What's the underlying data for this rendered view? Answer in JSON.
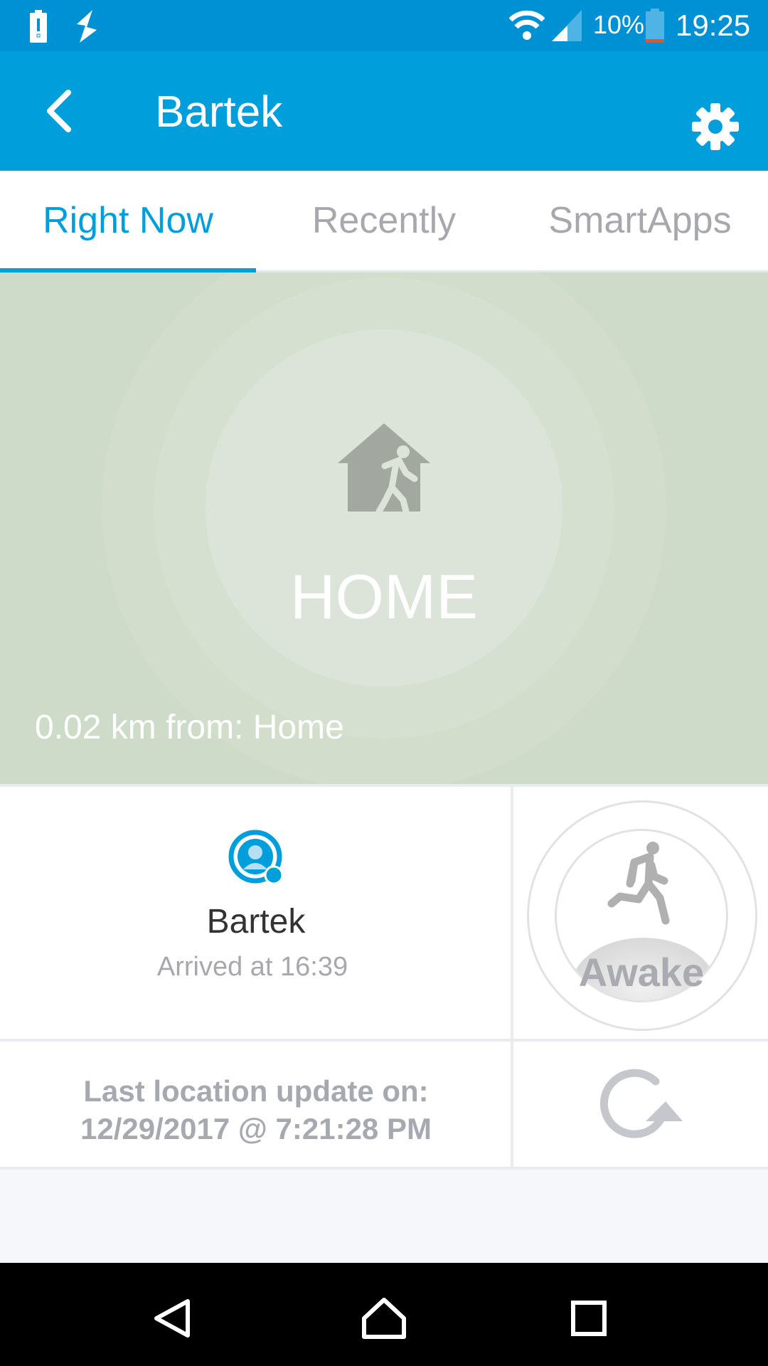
{
  "status_bar": {
    "battery_percent": "10%",
    "time": "19:25",
    "icons": [
      "battery-alert-icon",
      "flash-icon",
      "wifi-icon",
      "signal-icon",
      "battery-icon"
    ]
  },
  "app_bar": {
    "title": "Bartek",
    "back_icon": "chevron-left-icon",
    "settings_icon": "gear-icon"
  },
  "tabs": [
    {
      "label": "Right Now",
      "active": true
    },
    {
      "label": "Recently",
      "active": false
    },
    {
      "label": "SmartApps",
      "active": false
    }
  ],
  "presence": {
    "state": "HOME",
    "distance": "0.02 km from: Home",
    "icon": "home-person-icon"
  },
  "person": {
    "name": "Bartek",
    "arrived": "Arrived at 16:39",
    "icon": "user-avatar-icon"
  },
  "activity": {
    "label": "Awake",
    "icon": "running-person-icon"
  },
  "location_update": {
    "line1": "Last location update on:",
    "line2": "12/29/2017 @ 7:21:28 PM",
    "refresh_icon": "refresh-icon"
  },
  "nav_bar": {
    "icons": [
      "back-triangle-icon",
      "home-icon",
      "recents-square-icon"
    ]
  },
  "colors": {
    "accent": "#009fdb",
    "status_bar": "#0091d5",
    "map_bg": "#cfdbc9"
  }
}
